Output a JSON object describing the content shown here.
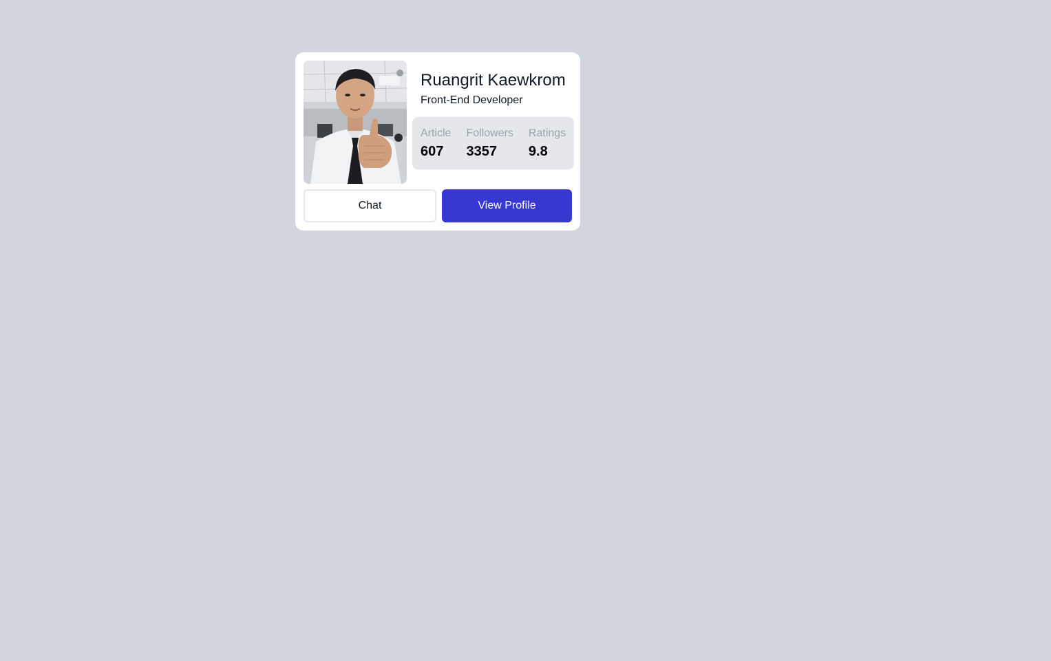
{
  "profile": {
    "name": "Ruangrit Kaewkrom",
    "role": "Front-End Developer",
    "photo_alt": "profile-photo"
  },
  "stats": [
    {
      "label": "Article",
      "value": "607"
    },
    {
      "label": "Followers",
      "value": "3357"
    },
    {
      "label": "Ratings",
      "value": "9.8"
    }
  ],
  "actions": {
    "chat_label": "Chat",
    "view_profile_label": "View Profile"
  },
  "colors": {
    "background": "#d1d5de",
    "card": "#ffffff",
    "stats_panel": "#e5e7eb",
    "primary": "#3737d2"
  }
}
